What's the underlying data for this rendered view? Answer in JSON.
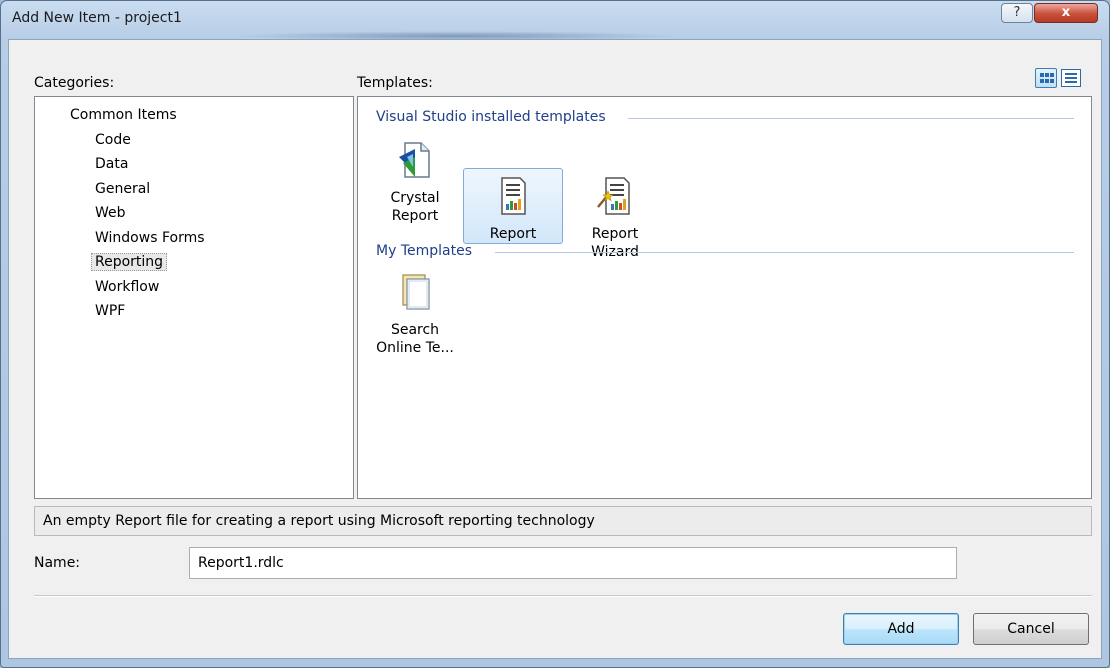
{
  "window": {
    "title": "Add New Item - project1",
    "help_glyph": "?",
    "close_glyph": "x"
  },
  "categories": {
    "label": "Categories:",
    "items": [
      {
        "label": "Common Items"
      },
      {
        "label": "Code"
      },
      {
        "label": "Data"
      },
      {
        "label": "General"
      },
      {
        "label": "Web"
      },
      {
        "label": "Windows Forms"
      },
      {
        "label": "Reporting",
        "selected": true
      },
      {
        "label": "Workflow"
      },
      {
        "label": "WPF"
      }
    ]
  },
  "templates": {
    "label": "Templates:",
    "view_buttons": [
      "large-icons-view-icon",
      "small-icons-view-icon"
    ],
    "groups": [
      {
        "header": "Visual Studio installed templates",
        "items": [
          {
            "line1": "Crystal",
            "line2": "Report",
            "icon": "crystal-report-icon"
          },
          {
            "line1": "Report",
            "line2": "",
            "icon": "report-icon",
            "selected": true
          },
          {
            "line1": "Report",
            "line2": "Wizard",
            "icon": "report-wizard-icon"
          }
        ]
      },
      {
        "header": "My Templates",
        "items": [
          {
            "line1": "Search",
            "line2": "Online Te...",
            "icon": "search-online-templates-icon"
          }
        ]
      }
    ]
  },
  "description": "An empty Report file for creating a report using Microsoft reporting technology",
  "name_field": {
    "label": "Name:",
    "value": "Report1.rdlc"
  },
  "buttons": {
    "add": "Add",
    "cancel": "Cancel"
  },
  "colors": {
    "accent": "#3c7fb1",
    "group_header": "#1e3f8a",
    "selection_bg": "#d2e7fa"
  }
}
